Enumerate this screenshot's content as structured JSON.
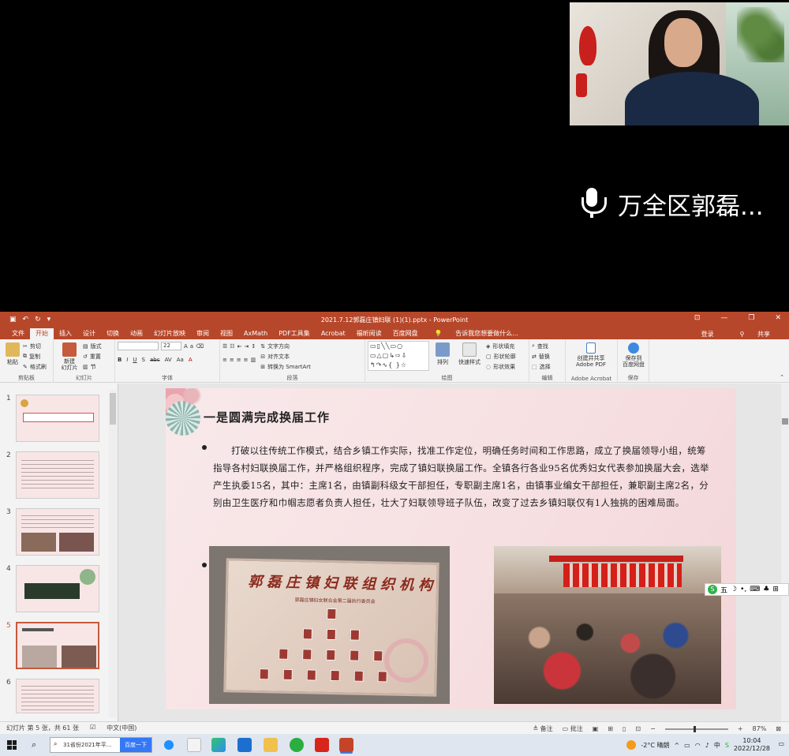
{
  "video": {
    "speaker_name": "万全区郭磊..."
  },
  "ppt": {
    "window_title": "2021.7.12郭磊庄镇妇联 (1)(1).pptx - PowerPoint",
    "tabs": [
      "文件",
      "开始",
      "插入",
      "设计",
      "切换",
      "动画",
      "幻灯片放映",
      "审阅",
      "视图",
      "AxMath",
      "PDF工具集",
      "Acrobat",
      "福昕阅读",
      "百度网盘"
    ],
    "tell_me": "告诉我您想要做什么...",
    "login": "登录",
    "share": "共享",
    "ribbon": {
      "clipboard": {
        "paste": "粘贴",
        "cut": "剪切",
        "copy": "复制",
        "format_painter": "格式刷",
        "label": "剪贴板"
      },
      "slides": {
        "new_slide": "新建\n幻灯片",
        "layout": "版式",
        "reset": "重置",
        "section": "节",
        "label": "幻灯片"
      },
      "font": {
        "size": "22",
        "label": "字体"
      },
      "paragraph": {
        "text_direction": "文字方向",
        "align_text": "对齐文本",
        "smartart": "转换为 SmartArt",
        "label": "段落"
      },
      "drawing": {
        "arrange": "排列",
        "quick_styles": "快速样式",
        "shape_fill": "形状填充",
        "shape_outline": "形状轮廓",
        "shape_effects": "形状效果",
        "label": "绘图"
      },
      "editing": {
        "find": "查找",
        "replace": "替换",
        "select": "选择",
        "label": "编辑"
      },
      "acrobat": {
        "create_share": "创建并共享\nAdobe PDF",
        "label": "Adobe Acrobat"
      },
      "save": {
        "save_baidu": "保存到\n百度网盘",
        "label": "保存"
      }
    },
    "slide": {
      "title": "一是圆满完成换届工作",
      "body": "打破以往传统工作模式，结合乡镇工作实际，找准工作定位，明确任务时间和工作思路，成立了换届领导小组，统筹指导各村妇联换届工作，并严格组织程序，完成了镇妇联换届工作。全镇各行各业95名优秀妇女代表参加换届大会，选举产生执委15名，其中：主席1名，由镇副科级女干部担任，专职副主席1名，由镇事业编女干部担任，兼职副主席2名，分别由卫生医疗和巾帼志愿者负责人担任，壮大了妇联领导班子队伍，改变了过去乡镇妇联仅有1人独挑的困难局面。",
      "board_title": "郭磊庄镇妇联组织机构",
      "board_subtitle": "郭磊庄镇妇女联合会第二届执行委员会"
    },
    "thumb_numbers": [
      "1",
      "2",
      "3",
      "4",
      "5",
      "6"
    ],
    "status": {
      "slide_info": "幻灯片 第 5 张，共 61 张",
      "language": "中文(中国)",
      "notes": "备注",
      "comments": "批注",
      "zoom": "87%"
    }
  },
  "ime": {
    "label": "五"
  },
  "taskbar": {
    "search_text": "31省份2021年平...",
    "search_button": "百度一下",
    "weather": "-2°C  晴朗",
    "input_lang": "中",
    "time": "10:04",
    "date": "2022/12/28"
  }
}
